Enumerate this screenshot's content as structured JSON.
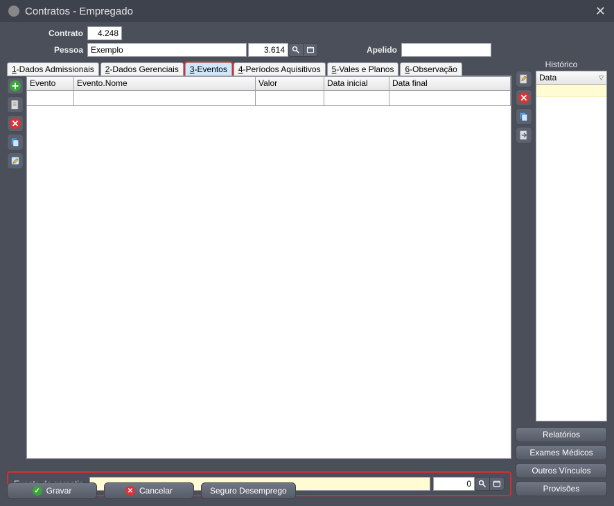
{
  "window": {
    "title": "Contratos - Empregado"
  },
  "header": {
    "contrato_label": "Contrato",
    "contrato_value": "4.248",
    "pessoa_label": "Pessoa",
    "pessoa_value": "Exemplo",
    "pessoa_code": "3.614",
    "apelido_label": "Apelido",
    "apelido_value": "",
    "historico_label": "Histórico"
  },
  "tabs": [
    {
      "num": "1",
      "label": "-Dados Admissionais"
    },
    {
      "num": "2",
      "label": "-Dados Gerenciais"
    },
    {
      "num": "3",
      "label": "-Eventos"
    },
    {
      "num": "4",
      "label": "-Períodos Aquisitivos"
    },
    {
      "num": "5",
      "label": "-Vales e Planos"
    },
    {
      "num": "6",
      "label": "-Observação"
    }
  ],
  "grid": {
    "columns": [
      "Evento",
      "Evento.Nome",
      "Valor",
      "Data inicial",
      "Data final"
    ]
  },
  "footer": {
    "evento_garantia_label": "Evento de garantia",
    "evento_garantia_text": "",
    "evento_garantia_code": "0"
  },
  "historico": {
    "column": "Data"
  },
  "right_buttons": {
    "relatorios": "Relatórios",
    "exames": "Exames Médicos",
    "vinculos": "Outros Vínculos",
    "provisoes": "Provisões"
  },
  "bottom_buttons": {
    "gravar": "Gravar",
    "cancelar": "Cancelar",
    "seguro": "Seguro Desemprego"
  }
}
